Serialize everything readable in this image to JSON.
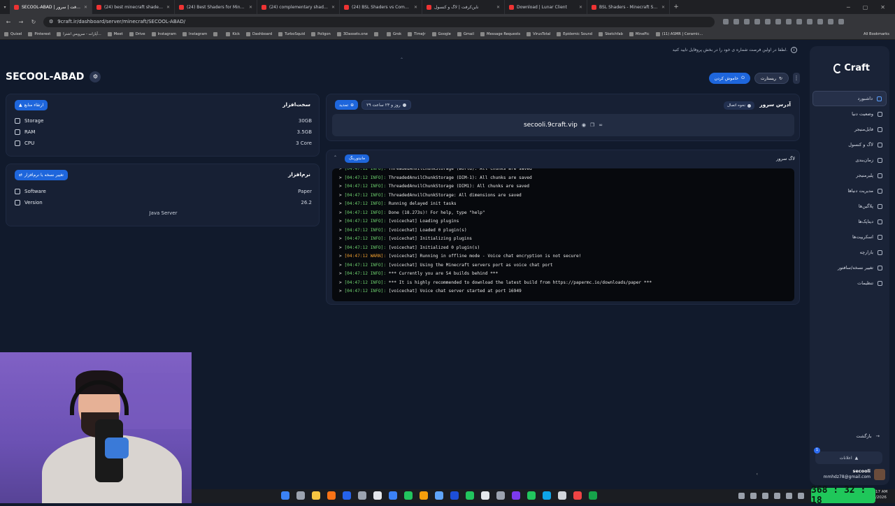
{
  "browser": {
    "tabs": [
      {
        "title": "SECOOL-ABAD | ناین‌کرفت | سرور",
        "active": true
      },
      {
        "title": "(24) best minecraft shaders high",
        "active": false
      },
      {
        "title": "(24) Best Shaders for Minecraft",
        "active": false
      },
      {
        "title": "(24) complementary shaders sp",
        "active": false
      },
      {
        "title": "(24) BSL Shaders vs Complemen",
        "active": false
      },
      {
        "title": "ناین‌کرفت | لاگ و کنسول",
        "active": false
      },
      {
        "title": "Download | Lunar Client",
        "active": false
      },
      {
        "title": "BSL Shaders - Minecraft Shade",
        "active": false
      }
    ],
    "url": "9craft.ir/dashboard/server/minecraft/SECOOL-ABAD/",
    "bookmarks": [
      "Quixel",
      "Pinterest",
      "آپارات - سرویس اشترا...",
      "Meet",
      "Drive",
      "Instagram",
      "Instagram",
      "",
      "Kick",
      "Dashboard",
      "TurboSquid",
      "Poligon",
      "3Dassets.one",
      "",
      "Grok",
      "TimeJr",
      "Google",
      "Gmail",
      "Message Requests",
      "VirusTotal",
      "Epidemic Sound",
      "Sketchfab",
      "MinePic",
      "(11) ASMR | Ceramic..."
    ],
    "all_bookmarks": "All Bookmarks"
  },
  "notice": "لطفا در اولین فرصت شماره ی خود را در بخش پروفایل تایید کنید.",
  "server": {
    "name": "SECOOL-ABAD",
    "restart_label": "ریستارت",
    "shutdown_label": "خاموش کردن"
  },
  "hardware": {
    "title": "سخت‌افزار",
    "upgrade_label": "ارتقاء منابع",
    "rows": [
      {
        "label": "Storage",
        "value": "30GB"
      },
      {
        "label": "RAM",
        "value": "3.5GB"
      },
      {
        "label": "CPU",
        "value": "3 Core"
      }
    ]
  },
  "software": {
    "title": "نرم‌افزار",
    "change_label": "تغییر نسخه یا نرم‌افزار",
    "rows": [
      {
        "label": "Software",
        "value": "Paper"
      },
      {
        "label": "Version",
        "value": "26.2"
      }
    ],
    "edition": "Java Server"
  },
  "address": {
    "title": "آدرس سرور",
    "connect_label": "نحوه اتصال",
    "remaining": "۲۹ روز و ۲۳ ساعت",
    "extend_label": "تمدید",
    "host": "secooli.9craft.vip"
  },
  "log": {
    "title": "لاگ سرور",
    "monitor_label": "مانیتورینگ",
    "lines": [
      {
        "ts": "[04:47:12 INFO]:",
        "msg": "ThreadedAnvilChunkStorage (world): All chunks are saved",
        "warn": false
      },
      {
        "ts": "[04:47:12 INFO]:",
        "msg": "ThreadedAnvilChunkStorage (DIM-1): All chunks are saved",
        "warn": false
      },
      {
        "ts": "[04:47:12 INFO]:",
        "msg": "ThreadedAnvilChunkStorage (DIM1): All chunks are saved",
        "warn": false
      },
      {
        "ts": "[04:47:12 INFO]:",
        "msg": "ThreadedAnvilChunkStorage: All dimensions are saved",
        "warn": false
      },
      {
        "ts": "[04:47:12 INFO]:",
        "msg": "Running delayed init tasks",
        "warn": false
      },
      {
        "ts": "[04:47:12 INFO]:",
        "msg": "Done (18.273s)! For help, type \"help\"",
        "warn": false
      },
      {
        "ts": "[04:47:12 INFO]:",
        "msg": "[voicechat] Loading plugins",
        "warn": false
      },
      {
        "ts": "[04:47:12 INFO]:",
        "msg": "[voicechat] Loaded 0 plugin(s)",
        "warn": false
      },
      {
        "ts": "[04:47:12 INFO]:",
        "msg": "[voicechat] Initializing plugins",
        "warn": false
      },
      {
        "ts": "[04:47:12 INFO]:",
        "msg": "[voicechat] Initialized 0 plugin(s)",
        "warn": false
      },
      {
        "ts": "[04:47:12 WARN]:",
        "msg": "[voicechat] Running in offline mode - Voice chat encryption is not secure!",
        "warn": true
      },
      {
        "ts": "[04:47:12 INFO]:",
        "msg": "[voicechat] Using the Minecraft servers port as voice chat port",
        "warn": false
      },
      {
        "ts": "[04:47:12 INFO]:",
        "msg": "*** Currently you are 54 builds behind ***",
        "warn": false
      },
      {
        "ts": "[04:47:12 INFO]:",
        "msg": "*** It is highly recommended to download the latest build from https://papermc.io/downloads/paper ***",
        "warn": false
      },
      {
        "ts": "[04:47:12 INFO]:",
        "msg": "[voicechat] Voice chat server started at port 16949",
        "warn": false
      }
    ]
  },
  "sidebar": {
    "logo": "Craft",
    "items": [
      {
        "label": "داشبورد",
        "active": true
      },
      {
        "label": "وضعیت دنیا",
        "active": false
      },
      {
        "label": "فایل‌منیجر",
        "active": false
      },
      {
        "label": "لاگ و کنسول",
        "active": false
      },
      {
        "label": "زمان‌بندی",
        "active": false
      },
      {
        "label": "پلیرمنیجر",
        "active": false
      },
      {
        "label": "مدیریت دنیاها",
        "active": false
      },
      {
        "label": "پلاگین‌ها",
        "active": false
      },
      {
        "label": "دیتاپک‌ها",
        "active": false
      },
      {
        "label": "اسکریپت‌ها",
        "active": false
      },
      {
        "label": "بازارچه",
        "active": false
      },
      {
        "label": "تغییر نسخه/سافتور",
        "active": false
      },
      {
        "label": "تنظیمات",
        "active": false
      }
    ],
    "back_label": "بازگشت",
    "notifications_label": "اعلانات",
    "notifications_count": "1",
    "user_name": "secooli",
    "user_email": "mmhdz78@gmail.com"
  },
  "overlay": {
    "timer": "368 : 32 : 18",
    "clock_time": "17 AM",
    "clock_date": "/2026"
  },
  "colors": {
    "accent": "#1e66dc",
    "bg": "#111a2c",
    "card": "#172034",
    "info": "#6fd26f",
    "warn": "#f0a030"
  }
}
